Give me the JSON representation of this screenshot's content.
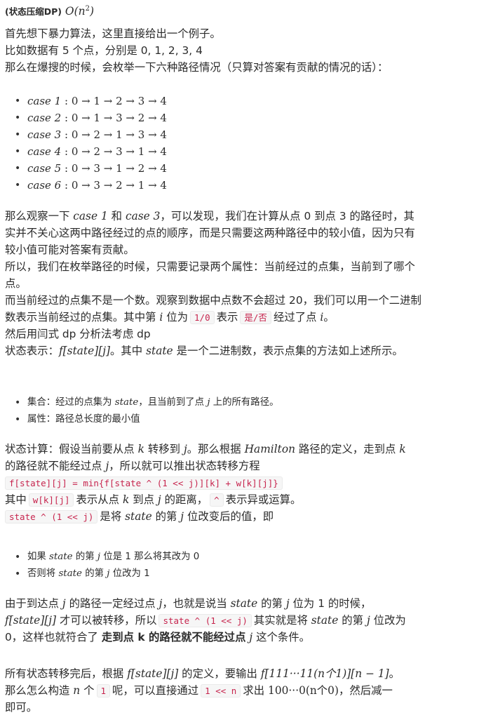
{
  "title": {
    "label": "(状态压缩DP)",
    "formula": "O(n",
    "exp": "2",
    "close": ")"
  },
  "intro": {
    "p1": "首先想下暴力算法，这里直接给出一个例子。",
    "p2": "比如数据有 5 个点，分别是 0, 1, 2, 3, 4",
    "p3": "那么在爆搜的时候，会枚举一下六种路径情况（只算对答案有贡献的情况的话）："
  },
  "cases": [
    {
      "name": "case 1",
      "path": "0 → 1 → 2 → 3 → 4"
    },
    {
      "name": "case 2",
      "path": "0 → 1 → 3 → 2 → 4"
    },
    {
      "name": "case 3",
      "path": "0 → 2 → 1 → 3 → 4"
    },
    {
      "name": "case 4",
      "path": "0 → 2 → 3 → 1 → 4"
    },
    {
      "name": "case 5",
      "path": "0 → 3 → 1 → 2 → 4"
    },
    {
      "name": "case 6",
      "path": "0 → 3 → 2 → 1 → 4"
    }
  ],
  "analysis": {
    "a": "那么观察一下",
    "case1": "case 1",
    "b": "和",
    "case3": "case 3",
    "c": "，可以发现，我们在计算从点 0 到点 3 的路径时，其",
    "l2": "实并不关心这两中路径经过的点的顺序，而是只需要这两种路径中的较小值，因为只有",
    "l3": "较小值可能对答案有贡献。",
    "l4": "所以，我们在枚举路径的时候，只需要记录两个属性：当前经过的点集，当前到了哪个",
    "l5": "点。",
    "l6": "而当前经过的点集不是一个数。观察到数据中点数不会超过 20，我们可以用一个二进制",
    "l7a": "数表示当前经过的点集。其中第",
    "l7i": "i",
    "l7b": "位为",
    "l7code1": "1/0",
    "l7c": "表示",
    "l7code2": "是/否",
    "l7d": "经过了点",
    "l7e": "i",
    "l7f": "。",
    "l8": "然后用闫式 dp 分析法考虑 dp",
    "l9a": "状态表示：",
    "l9f": "f[state][j]",
    "l9b": "。其中",
    "l9s": "state",
    "l9c": "是一个二进制数，表示点集的方法如上述所示。"
  },
  "state_items": {
    "i1a": "集合：经过的点集为",
    "i1s": "state",
    "i1b": "，且当前到了点",
    "i1j": "j",
    "i1c": "上的所有路径。",
    "i2": "属性：路径总长度的最小值"
  },
  "calc": {
    "l1a": "状态计算：假设当前要从点",
    "l1k": "k",
    "l1b": "转移到",
    "l1j": "j",
    "l1c": "。那么根据",
    "l1h": "Hamilton",
    "l1d": "路径的定义，走到点",
    "l1k2": "k",
    "l2a": "的路径就不能经过点",
    "l2j": "j",
    "l2b": "，所以就可以推出状态转移方程",
    "code": "f[state][j] = min{f[state ^ (1 << j)][k] + w[k][j]}",
    "l4a": "其中",
    "l4code": "w[k][j]",
    "l4b": "表示从点",
    "l4k": "k",
    "l4c": "到点",
    "l4j": "j",
    "l4d": "的距离，",
    "l4code2": "^",
    "l4e": "表示异或运算。",
    "l5code": "state ^ (1 << j)",
    "l5a": "是将",
    "l5s": "state",
    "l5b": "的第",
    "l5j": "j",
    "l5c": "位改变后的值，即"
  },
  "bit_items": {
    "i1a": "如果",
    "i1s": "state",
    "i1b": "的第",
    "i1j": "j",
    "i1c": "位是 1 那么将其改为 0",
    "i2a": "否则将",
    "i2s": "state",
    "i2b": "的第",
    "i2j": "j",
    "i2c": "位改为 1"
  },
  "conclusion": {
    "l1a": "由于到达点",
    "l1j": "j",
    "l1b": "的路径一定经过点",
    "l1j2": "j",
    "l1c": "，也就是说当",
    "l1s": "state",
    "l1d": "的第",
    "l1j3": "j",
    "l1e": "位为 1 的时候，",
    "l2f": "f[state][j]",
    "l2a": "才可以被转移，所以",
    "l2code": "state ^ (1 << j)",
    "l2b": "其实就是将",
    "l2s": "state",
    "l2c": "的第",
    "l2j": "j",
    "l2d": "位改为",
    "l3a": "0，这样也就符合了",
    "l3strong": "走到点 k 的路径就不能经过点",
    "l3j": "j",
    "l3b": "这个条件。"
  },
  "final": {
    "l1a": "所有状态转移完后，根据",
    "l1f": "f[state][j]",
    "l1b": "的定义，要输出",
    "l1f2": "f[111···11(n个1)][n − 1]",
    "l1c": "。",
    "l2a": "那么怎么构造",
    "l2n": "n",
    "l2b": "个",
    "l2code": "1",
    "l2c": "呢，可以直接通过",
    "l2code2": "1 << n",
    "l2d": "求出",
    "l2v": "100···0(n个0)",
    "l2e": "，然后减一",
    "l3": "即可。"
  }
}
